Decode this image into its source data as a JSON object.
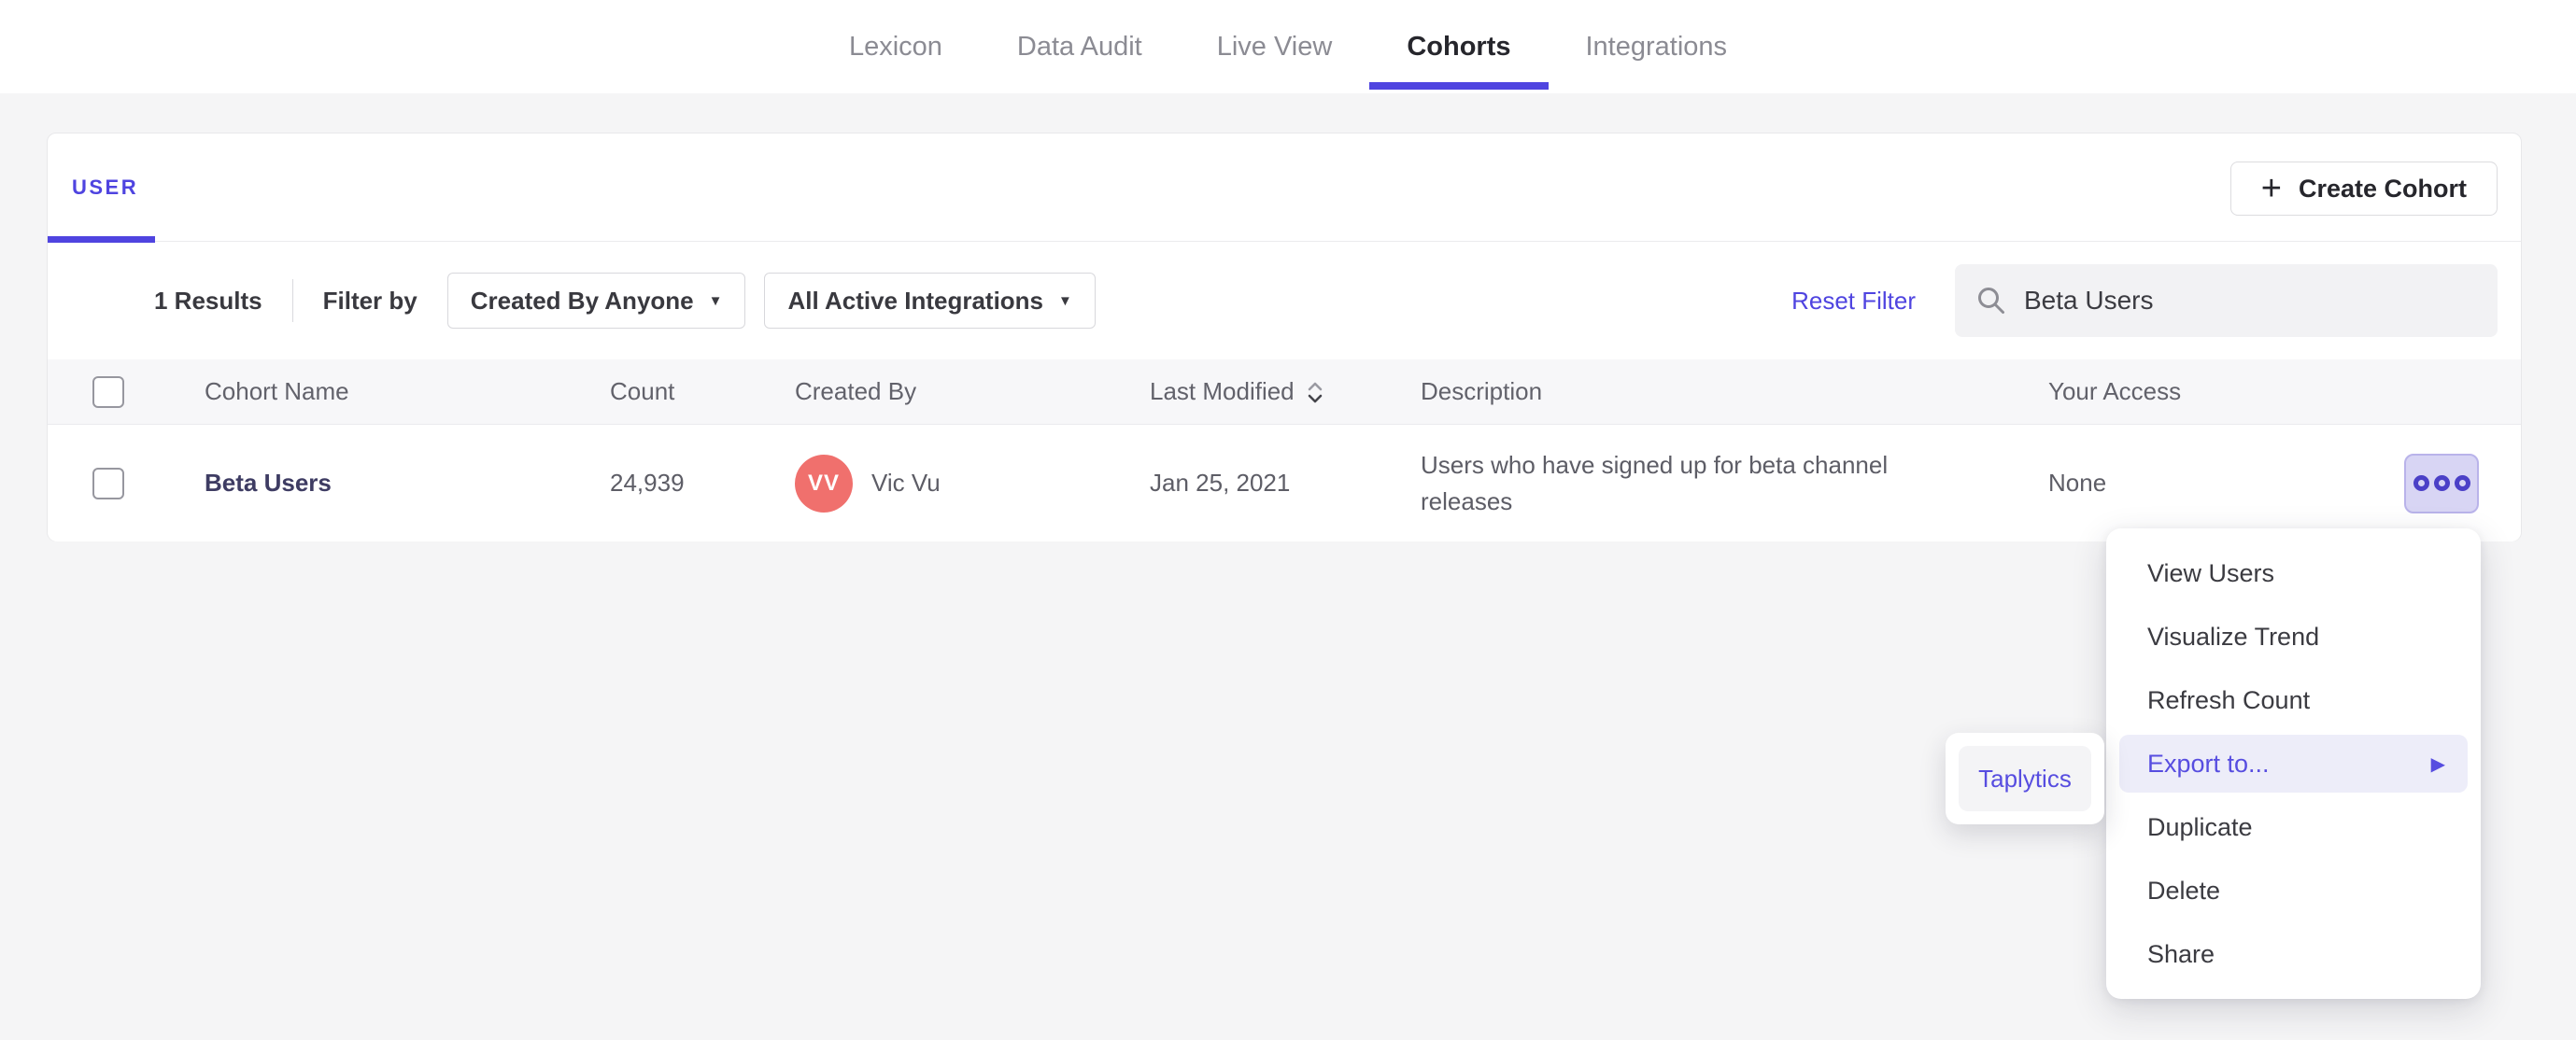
{
  "nav": {
    "tabs": [
      {
        "label": "Lexicon"
      },
      {
        "label": "Data Audit"
      },
      {
        "label": "Live View"
      },
      {
        "label": "Cohorts",
        "active": true
      },
      {
        "label": "Integrations"
      }
    ]
  },
  "card": {
    "tab_user": "USER",
    "create_cohort": {
      "plus_icon": "+",
      "label": "Create Cohort"
    },
    "filters": {
      "results": "1 Results",
      "filter_by": "Filter by",
      "created_by_dropdown": {
        "label": "Created By Anyone",
        "caret": "▼"
      },
      "integrations_dropdown": {
        "label": "All Active Integrations",
        "caret": "▼"
      },
      "reset": "Reset Filter",
      "search": {
        "value": "Beta Users"
      }
    },
    "table": {
      "headers": {
        "name": "Cohort Name",
        "count": "Count",
        "created_by": "Created By",
        "last_modified": "Last Modified",
        "description": "Description",
        "access": "Your Access"
      },
      "rows": [
        {
          "name": "Beta Users",
          "count": "24,939",
          "avatar_initials": "VV",
          "created_by": "Vic Vu",
          "last_modified": "Jan 25, 2021",
          "description": "Users who have signed up for beta channel releases",
          "access": "None"
        }
      ]
    }
  },
  "context_menu": {
    "items": [
      {
        "label": "View Users"
      },
      {
        "label": "Visualize Trend"
      },
      {
        "label": "Refresh Count"
      },
      {
        "label": "Export to...",
        "highlighted": true,
        "submenu_arrow": "▶"
      },
      {
        "label": "Duplicate"
      },
      {
        "label": "Delete"
      },
      {
        "label": "Share"
      }
    ]
  },
  "export_submenu": {
    "items": [
      {
        "label": "Taplytics"
      }
    ]
  },
  "colors": {
    "accent_purple": "#4f44e0",
    "menu_highlight_bg": "#ededf9",
    "menu_highlight_text": "#574de0",
    "avatar_bg": "#f0706d",
    "actions_button_bg": "#d8d5f4",
    "actions_button_border": "#b9b3ea",
    "page_bg": "#f5f5f6",
    "cohort_link": "#3e3c63"
  }
}
